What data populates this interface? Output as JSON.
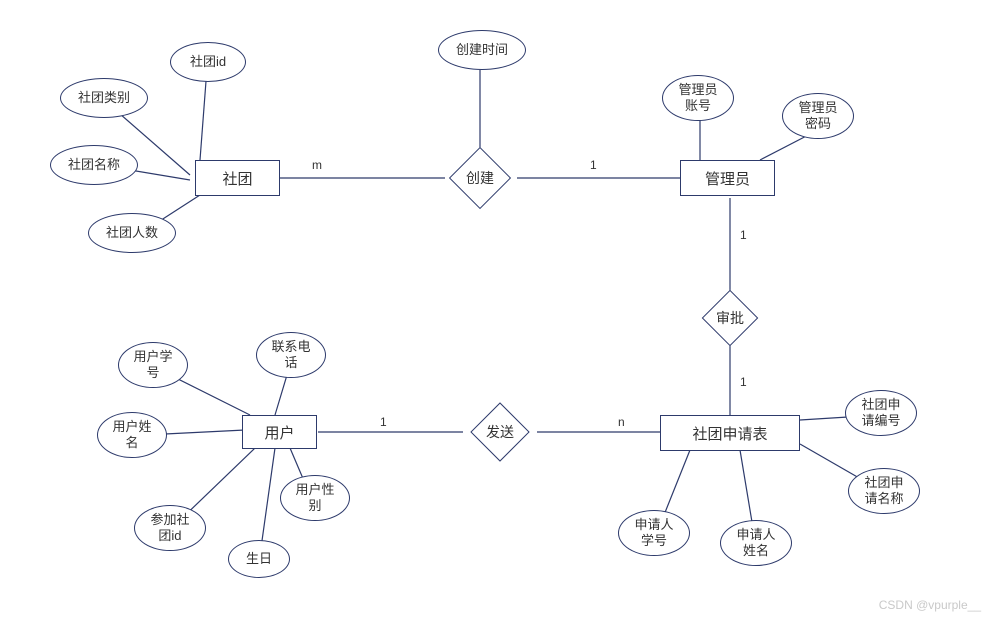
{
  "entities": {
    "club": "社团",
    "admin": "管理员",
    "user": "用户",
    "application": "社团申请表"
  },
  "relationships": {
    "create": "创建",
    "approve": "审批",
    "send": "发送"
  },
  "attributes": {
    "club_id": "社团id",
    "club_category": "社团类别",
    "club_name": "社团名称",
    "club_members": "社团人数",
    "create_time": "创建时间",
    "admin_account": "管理员\n账号",
    "admin_password": "管理员\n密码",
    "user_sid": "用户学\n号",
    "user_phone": "联系电\n话",
    "user_name": "用户姓\n名",
    "user_gender": "用户性\n别",
    "user_joined_club": "参加社\n团id",
    "user_birthday": "生日",
    "app_id": "社团申\n请编号",
    "app_name": "社团申\n请名称",
    "applicant_sid": "申请人\n学号",
    "applicant_name": "申请人\n姓名"
  },
  "cardinalities": {
    "create_left": "m",
    "create_right": "1",
    "approve_top": "1",
    "approve_bottom": "1",
    "send_left": "1",
    "send_right": "n"
  },
  "watermark": "CSDN @vpurple__"
}
